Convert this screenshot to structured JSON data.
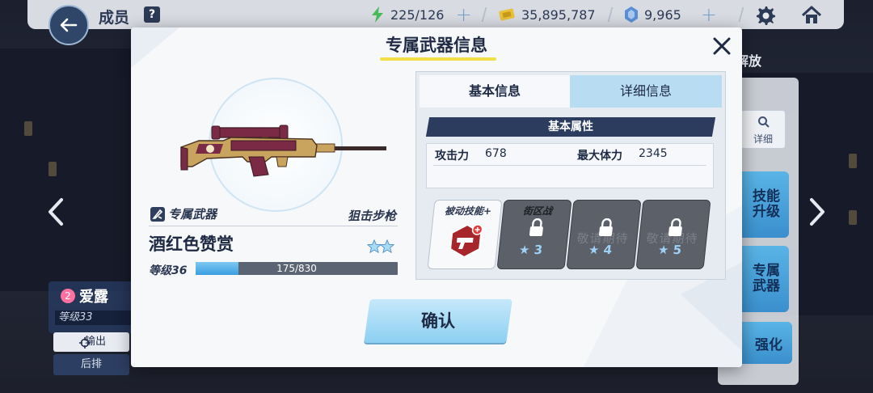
{
  "topbar": {
    "title": "成员",
    "help": "?",
    "energy": "225/126",
    "coins": "35,895,787",
    "gems": "9,965"
  },
  "side_menu": {
    "top_label": "解放",
    "detail_label": "详细",
    "skill_upgrade": "技能升级",
    "exclusive_weapon": "专属武器",
    "enhance": "强化"
  },
  "character": {
    "rank": "2",
    "name": "爱露",
    "level": "等级33",
    "role": "输出",
    "row": "后排"
  },
  "modal": {
    "title": "专属武器信息",
    "weapon_type": "专属武器",
    "weapon_class": "狙击步枪",
    "weapon_name": "酒红色赞赏",
    "star_count": 2,
    "level": "等级36",
    "xp_text": "175/830",
    "xp_fraction": 0.21,
    "tabs": {
      "basic": "基本信息",
      "detail": "详细信息"
    },
    "attributes_header": "基本属性",
    "attributes": [
      {
        "key": "攻击力",
        "value": "678"
      },
      {
        "key": "最大体力",
        "value": "2345"
      }
    ],
    "skills": [
      {
        "title": "被动技能+",
        "locked": false
      },
      {
        "title": "街区战",
        "locked": true,
        "stars": "3"
      },
      {
        "title": "",
        "locked": true,
        "stars": "4",
        "ghost": "敬请期待"
      },
      {
        "title": "",
        "locked": true,
        "stars": "5",
        "ghost": "敬请期待"
      }
    ],
    "confirm_label": "确认"
  },
  "colors": {
    "accent_yellow": "#f2de46",
    "navy": "#2b3c5e",
    "light_blue": "#8ccff2",
    "weapon_gold": "#c9a45e",
    "weapon_wine": "#7a2a45"
  }
}
